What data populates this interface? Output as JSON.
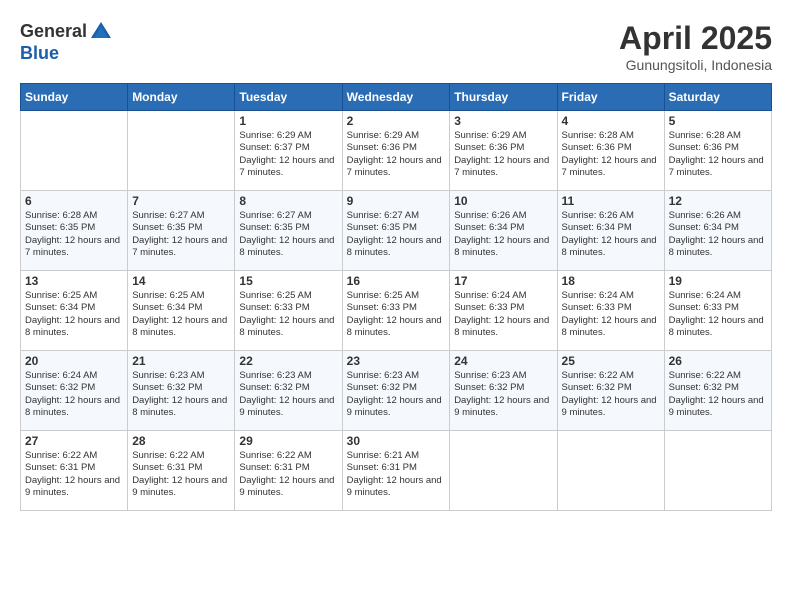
{
  "logo": {
    "general": "General",
    "blue": "Blue"
  },
  "title": "April 2025",
  "location": "Gunungsitoli, Indonesia",
  "days_header": [
    "Sunday",
    "Monday",
    "Tuesday",
    "Wednesday",
    "Thursday",
    "Friday",
    "Saturday"
  ],
  "weeks": [
    [
      {
        "day": "",
        "info": ""
      },
      {
        "day": "",
        "info": ""
      },
      {
        "day": "1",
        "info": "Sunrise: 6:29 AM\nSunset: 6:37 PM\nDaylight: 12 hours and 7 minutes."
      },
      {
        "day": "2",
        "info": "Sunrise: 6:29 AM\nSunset: 6:36 PM\nDaylight: 12 hours and 7 minutes."
      },
      {
        "day": "3",
        "info": "Sunrise: 6:29 AM\nSunset: 6:36 PM\nDaylight: 12 hours and 7 minutes."
      },
      {
        "day": "4",
        "info": "Sunrise: 6:28 AM\nSunset: 6:36 PM\nDaylight: 12 hours and 7 minutes."
      },
      {
        "day": "5",
        "info": "Sunrise: 6:28 AM\nSunset: 6:36 PM\nDaylight: 12 hours and 7 minutes."
      }
    ],
    [
      {
        "day": "6",
        "info": "Sunrise: 6:28 AM\nSunset: 6:35 PM\nDaylight: 12 hours and 7 minutes."
      },
      {
        "day": "7",
        "info": "Sunrise: 6:27 AM\nSunset: 6:35 PM\nDaylight: 12 hours and 7 minutes."
      },
      {
        "day": "8",
        "info": "Sunrise: 6:27 AM\nSunset: 6:35 PM\nDaylight: 12 hours and 8 minutes."
      },
      {
        "day": "9",
        "info": "Sunrise: 6:27 AM\nSunset: 6:35 PM\nDaylight: 12 hours and 8 minutes."
      },
      {
        "day": "10",
        "info": "Sunrise: 6:26 AM\nSunset: 6:34 PM\nDaylight: 12 hours and 8 minutes."
      },
      {
        "day": "11",
        "info": "Sunrise: 6:26 AM\nSunset: 6:34 PM\nDaylight: 12 hours and 8 minutes."
      },
      {
        "day": "12",
        "info": "Sunrise: 6:26 AM\nSunset: 6:34 PM\nDaylight: 12 hours and 8 minutes."
      }
    ],
    [
      {
        "day": "13",
        "info": "Sunrise: 6:25 AM\nSunset: 6:34 PM\nDaylight: 12 hours and 8 minutes."
      },
      {
        "day": "14",
        "info": "Sunrise: 6:25 AM\nSunset: 6:34 PM\nDaylight: 12 hours and 8 minutes."
      },
      {
        "day": "15",
        "info": "Sunrise: 6:25 AM\nSunset: 6:33 PM\nDaylight: 12 hours and 8 minutes."
      },
      {
        "day": "16",
        "info": "Sunrise: 6:25 AM\nSunset: 6:33 PM\nDaylight: 12 hours and 8 minutes."
      },
      {
        "day": "17",
        "info": "Sunrise: 6:24 AM\nSunset: 6:33 PM\nDaylight: 12 hours and 8 minutes."
      },
      {
        "day": "18",
        "info": "Sunrise: 6:24 AM\nSunset: 6:33 PM\nDaylight: 12 hours and 8 minutes."
      },
      {
        "day": "19",
        "info": "Sunrise: 6:24 AM\nSunset: 6:33 PM\nDaylight: 12 hours and 8 minutes."
      }
    ],
    [
      {
        "day": "20",
        "info": "Sunrise: 6:24 AM\nSunset: 6:32 PM\nDaylight: 12 hours and 8 minutes."
      },
      {
        "day": "21",
        "info": "Sunrise: 6:23 AM\nSunset: 6:32 PM\nDaylight: 12 hours and 8 minutes."
      },
      {
        "day": "22",
        "info": "Sunrise: 6:23 AM\nSunset: 6:32 PM\nDaylight: 12 hours and 9 minutes."
      },
      {
        "day": "23",
        "info": "Sunrise: 6:23 AM\nSunset: 6:32 PM\nDaylight: 12 hours and 9 minutes."
      },
      {
        "day": "24",
        "info": "Sunrise: 6:23 AM\nSunset: 6:32 PM\nDaylight: 12 hours and 9 minutes."
      },
      {
        "day": "25",
        "info": "Sunrise: 6:22 AM\nSunset: 6:32 PM\nDaylight: 12 hours and 9 minutes."
      },
      {
        "day": "26",
        "info": "Sunrise: 6:22 AM\nSunset: 6:32 PM\nDaylight: 12 hours and 9 minutes."
      }
    ],
    [
      {
        "day": "27",
        "info": "Sunrise: 6:22 AM\nSunset: 6:31 PM\nDaylight: 12 hours and 9 minutes."
      },
      {
        "day": "28",
        "info": "Sunrise: 6:22 AM\nSunset: 6:31 PM\nDaylight: 12 hours and 9 minutes."
      },
      {
        "day": "29",
        "info": "Sunrise: 6:22 AM\nSunset: 6:31 PM\nDaylight: 12 hours and 9 minutes."
      },
      {
        "day": "30",
        "info": "Sunrise: 6:21 AM\nSunset: 6:31 PM\nDaylight: 12 hours and 9 minutes."
      },
      {
        "day": "",
        "info": ""
      },
      {
        "day": "",
        "info": ""
      },
      {
        "day": "",
        "info": ""
      }
    ]
  ]
}
